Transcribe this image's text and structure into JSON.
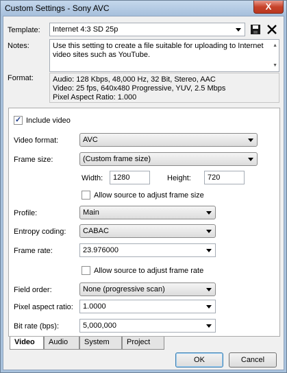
{
  "window": {
    "title": "Custom Settings - Sony AVC",
    "close_glyph": "X"
  },
  "template": {
    "label": "Template:",
    "value": "Internet 4:3 SD 25p"
  },
  "notes": {
    "label": "Notes:",
    "value": "Use this setting to create a file suitable for uploading to Internet video sites such as YouTube."
  },
  "format": {
    "label": "Format:",
    "lines": [
      "Audio: 128 Kbps, 48,000 Hz, 32 Bit, Stereo, AAC",
      "Video: 25 fps, 640x480 Progressive, YUV, 2.5 Mbps",
      "Pixel Aspect Ratio: 1.000"
    ]
  },
  "video": {
    "include_label": "Include video",
    "include_checked": true,
    "video_format": {
      "label": "Video format:",
      "value": "AVC"
    },
    "frame_size": {
      "label": "Frame size:",
      "value": "(Custom frame size)"
    },
    "width": {
      "label": "Width:",
      "value": "1280"
    },
    "height": {
      "label": "Height:",
      "value": "720"
    },
    "allow_frame_size": {
      "label": "Allow source to adjust frame size",
      "checked": false
    },
    "profile": {
      "label": "Profile:",
      "value": "Main"
    },
    "entropy": {
      "label": "Entropy coding:",
      "value": "CABAC"
    },
    "frame_rate": {
      "label": "Frame rate:",
      "value": "23.976000"
    },
    "allow_frame_rate": {
      "label": "Allow source to adjust frame rate",
      "checked": false
    },
    "field_order": {
      "label": "Field order:",
      "value": "None (progressive scan)"
    },
    "pixel_aspect": {
      "label": "Pixel aspect ratio:",
      "value": "1.0000"
    },
    "bit_rate": {
      "label": "Bit rate (bps):",
      "value": "5,000,000"
    }
  },
  "tabs": [
    {
      "label": "Video",
      "active": true
    },
    {
      "label": "Audio",
      "active": false
    },
    {
      "label": "System",
      "active": false
    },
    {
      "label": "Project",
      "active": false
    }
  ],
  "buttons": {
    "ok": "OK",
    "cancel": "Cancel"
  }
}
